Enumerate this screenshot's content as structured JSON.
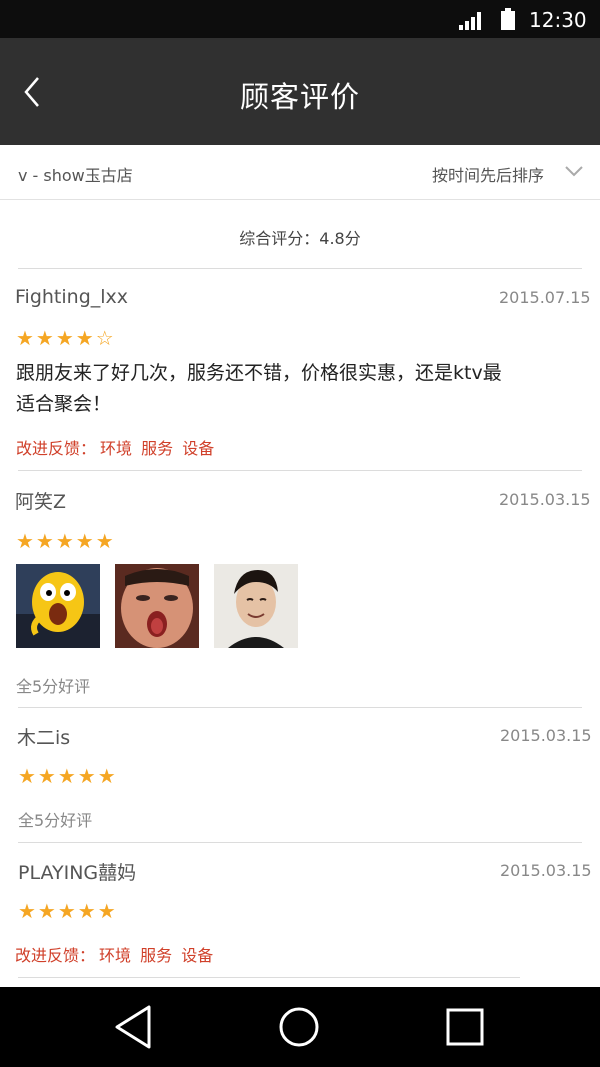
{
  "status_bar": {
    "time": "12:30"
  },
  "header": {
    "title": "顾客评价"
  },
  "filter": {
    "store": "v - show玉古店",
    "sort": "按时间先后排序"
  },
  "overall": {
    "text": "综合评分：4.8分"
  },
  "reviews": [
    {
      "user": "Fighting_lxx",
      "date": "2015.07.15",
      "stars": "★★★★☆",
      "rating": 4,
      "text_line1": "跟朋友来了好几次，服务还不错，价格很实惠，还是ktv最",
      "text_line2": "适合聚会！",
      "feedback_label": "改进反馈：",
      "feedback_tags": [
        "环境",
        "服务",
        "设备"
      ]
    },
    {
      "user": "阿笑Z",
      "date": "2015.03.15",
      "stars": "★★★★★",
      "rating": 5,
      "photos": [
        "cartoon-avatar-photo",
        "open-mouth-face-photo",
        "smiling-man-photo"
      ],
      "note": "全5分好评"
    },
    {
      "user": "木二is",
      "date": "2015.03.15",
      "stars": "★★★★★",
      "rating": 5,
      "note": "全5分好评"
    },
    {
      "user": "PLAYING囍妈",
      "date": "2015.03.15",
      "stars": "★★★★★",
      "rating": 5,
      "feedback_label": "改进反馈：",
      "feedback_tags": [
        "环境",
        "服务",
        "设备"
      ]
    }
  ],
  "colors": {
    "star": "#f5a623",
    "feedback": "#d0402a",
    "app_bar": "#303030"
  }
}
